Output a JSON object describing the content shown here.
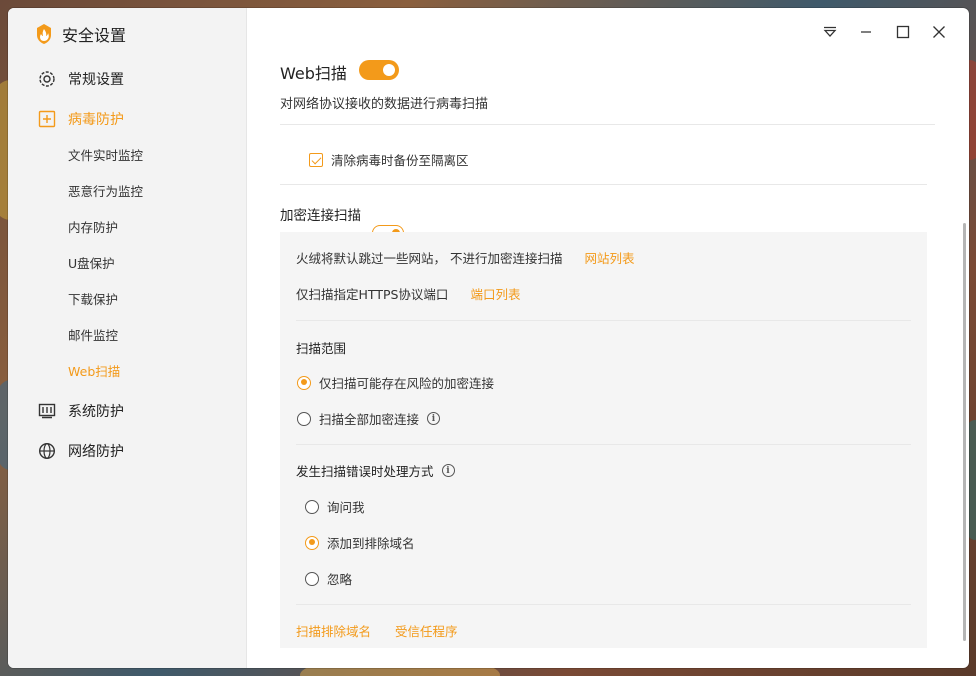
{
  "window": {
    "title": "安全设置"
  },
  "sidebar": {
    "items": [
      {
        "label": "常规设置",
        "icon": "gear-icon"
      },
      {
        "label": "病毒防护",
        "icon": "plus-square-icon"
      },
      {
        "label": "系统防护",
        "icon": "system-panel-icon"
      },
      {
        "label": "网络防护",
        "icon": "globe-icon"
      }
    ],
    "subitems": [
      {
        "label": "文件实时监控"
      },
      {
        "label": "恶意行为监控"
      },
      {
        "label": "内存防护"
      },
      {
        "label": "U盘保护"
      },
      {
        "label": "下载保护"
      },
      {
        "label": "邮件监控"
      },
      {
        "label": "Web扫描"
      }
    ]
  },
  "main": {
    "title": "Web扫描",
    "description": "对网络协议接收的数据进行病毒扫描",
    "backup_checkbox_label": "清除病毒时备份至隔离区",
    "encrypted": {
      "title": "加密连接扫描",
      "skip_text": "火绒将默认跳过一些网站， 不进行加密连接扫描",
      "site_list_link": "网站列表",
      "https_text": "仅扫描指定HTTPS协议端口",
      "port_list_link": "端口列表",
      "scope_title": "扫描范围",
      "scope_options": [
        {
          "label": "仅扫描可能存在风险的加密连接",
          "selected": true
        },
        {
          "label": "扫描全部加密连接",
          "selected": false
        }
      ],
      "error_title": "发生扫描错误时处理方式",
      "error_options": [
        {
          "label": "询问我",
          "selected": false
        },
        {
          "label": "添加到排除域名",
          "selected": true
        },
        {
          "label": "忽略",
          "selected": false
        }
      ],
      "footer_links": [
        "扫描排除域名",
        "受信任程序"
      ]
    }
  },
  "colors": {
    "accent": "#f39a1a"
  }
}
